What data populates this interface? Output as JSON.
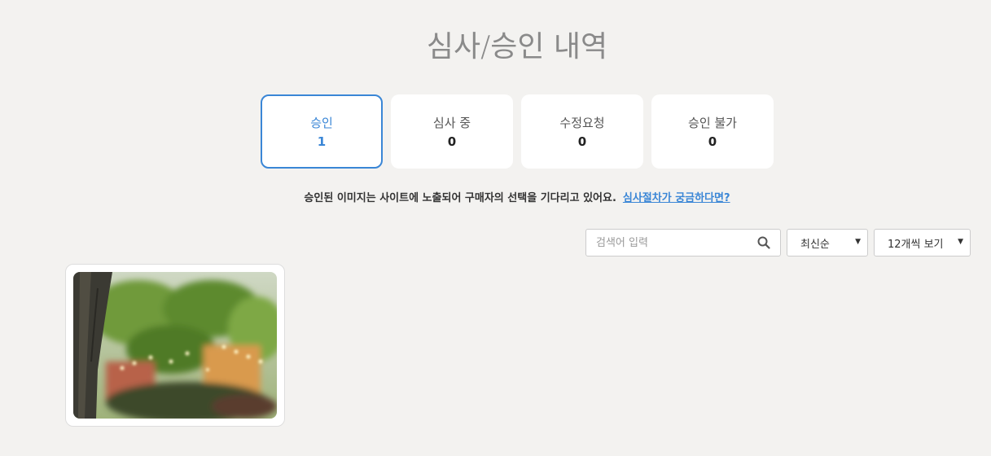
{
  "header": {
    "title": "심사/승인 내역"
  },
  "tabs": [
    {
      "label": "승인",
      "count": "1",
      "active": true
    },
    {
      "label": "심사 중",
      "count": "0",
      "active": false
    },
    {
      "label": "수정요청",
      "count": "0",
      "active": false
    },
    {
      "label": "승인 불가",
      "count": "0",
      "active": false
    }
  ],
  "info": {
    "message": "승인된 이미지는 사이트에 노출되어 구매자의 선택을 기다리고 있어요.",
    "link": "심사절차가 궁금하다면?"
  },
  "toolbar": {
    "search_placeholder": "검색어 입력",
    "search_icon": "search-icon",
    "sort_value": "최신순",
    "perpage_value": "12개씩 보기",
    "caret_icon": "chevron-down-icon"
  },
  "colors": {
    "accent": "#3a86d6",
    "background": "#f3f2f0"
  },
  "gallery": {
    "items": [
      {
        "thumbnail": "blurred-cafe-street-with-tree-photo"
      }
    ]
  }
}
